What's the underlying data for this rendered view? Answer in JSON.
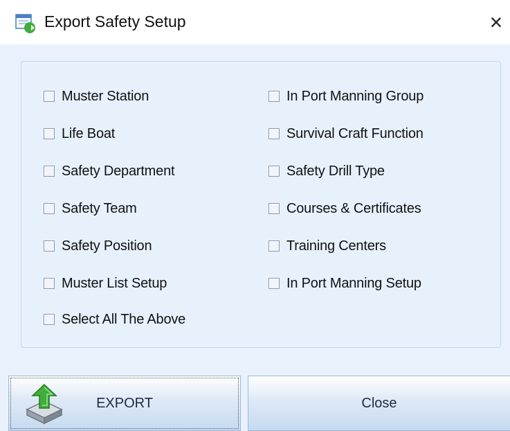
{
  "window": {
    "title": "Export Safety Setup",
    "close_glyph": "×"
  },
  "options": {
    "left": [
      {
        "label": "Muster Station",
        "checked": false
      },
      {
        "label": "Life Boat",
        "checked": false
      },
      {
        "label": "Safety Department",
        "checked": false
      },
      {
        "label": "Safety Team",
        "checked": false
      },
      {
        "label": "Safety Position",
        "checked": false
      },
      {
        "label": "Muster List Setup",
        "checked": false
      },
      {
        "label": "Select All The Above",
        "checked": false
      }
    ],
    "right": [
      {
        "label": "In Port Manning Group",
        "checked": false
      },
      {
        "label": "Survival Craft Function",
        "checked": false
      },
      {
        "label": "Safety Drill Type",
        "checked": false
      },
      {
        "label": "Courses & Certificates",
        "checked": false
      },
      {
        "label": "Training Centers",
        "checked": false
      },
      {
        "label": "In Port Manning Setup",
        "checked": false
      }
    ]
  },
  "buttons": {
    "export_label": "EXPORT",
    "close_label": "Close"
  },
  "icons": {
    "app": "export-window-icon",
    "export": "tray-upload-arrow-icon",
    "close": "close-icon"
  },
  "colors": {
    "client_bg": "#e9f2fc",
    "border": "#c4d7ee",
    "arrow_green": "#3fae3a"
  }
}
